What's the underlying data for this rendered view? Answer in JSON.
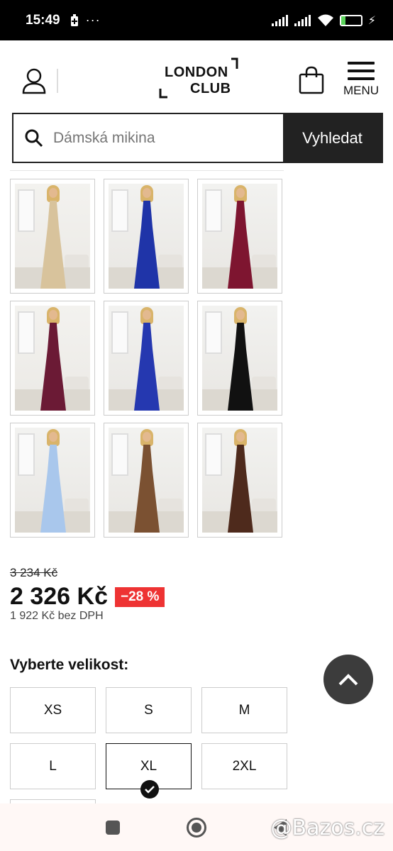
{
  "status_bar": {
    "time": "15:49",
    "battery": "23",
    "icons": [
      "battery-saver-icon",
      "more-icon",
      "signal-icon",
      "signal-icon",
      "wifi-icon",
      "charging-icon"
    ]
  },
  "header": {
    "logo_line1": "LONDON",
    "logo_line2": "CLUB",
    "menu_label": "MENU"
  },
  "search": {
    "placeholder": "Dámská mikina",
    "button_label": "Vyhledat"
  },
  "gallery": {
    "variants": [
      {
        "color": "#d8c39c",
        "hair": "light"
      },
      {
        "color": "#1f34a8",
        "hair": "light"
      },
      {
        "color": "#7e1530",
        "hair": "light"
      },
      {
        "color": "#6b1a35",
        "hair": "light"
      },
      {
        "color": "#2538b0",
        "hair": "light"
      },
      {
        "color": "#111111",
        "hair": "light"
      },
      {
        "color": "#a9c7ec",
        "hair": "light"
      },
      {
        "color": "#7b5132",
        "hair": "light"
      },
      {
        "color": "#4e2a1c",
        "hair": "light"
      }
    ]
  },
  "pricing": {
    "old_price": "3 234 Kč",
    "price": "2 326 Kč",
    "discount": "−28 %",
    "price_without_vat": "1 922 Kč bez DPH"
  },
  "sizes": {
    "title": "Vyberte velikost:",
    "options": [
      "XS",
      "S",
      "M",
      "L",
      "XL",
      "2XL"
    ],
    "selected": "XL"
  },
  "watermark": "@Bazos.cz"
}
